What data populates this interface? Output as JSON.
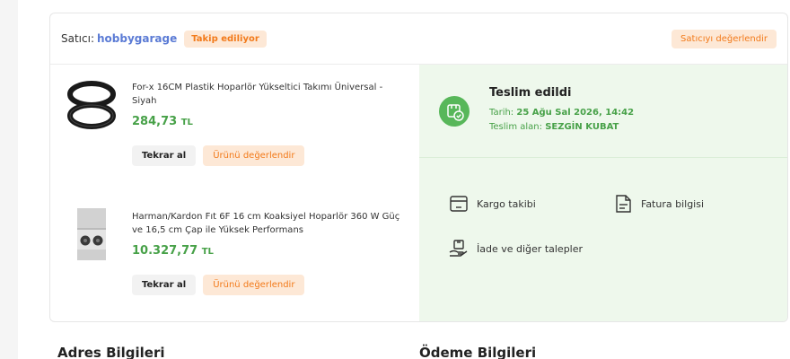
{
  "seller": {
    "prefix": "Satıcı:",
    "name": "hobbygarage",
    "follow_badge": "Takip ediliyor",
    "rate_button": "Satıcıyı değerlendir"
  },
  "products": [
    {
      "title": "For-x 16CM Plastik Hoparlör Yükseltici Takımı Üniversal - Siyah",
      "price": "284,73",
      "currency": "TL",
      "rebuy_label": "Tekrar al",
      "rate_label": "Ürünü değerlendir"
    },
    {
      "title": "Harman/Kardon Fıt 6F 16 cm Koaksiyel Hoparlör 360 W Güç ve 16,5 cm Çap ile Yüksek Performans",
      "price": "10.327,77",
      "currency": "TL",
      "rebuy_label": "Tekrar al",
      "rate_label": "Ürünü değerlendir"
    }
  ],
  "delivery": {
    "title": "Teslim edildi",
    "date_label": "Tarih:",
    "date_value": "25 Ağu Sal 2026, 14:42",
    "receiver_label": "Teslim alan:",
    "receiver_value": "SEZGİN KUBAT",
    "accent_color": "#58b75a"
  },
  "actions": {
    "cargo": "Kargo takibi",
    "invoice": "Fatura bilgisi",
    "returns": "İade ve diğer talepler"
  },
  "sections": {
    "address": "Adres Bilgileri",
    "payment": "Ödeme Bilgileri"
  },
  "colors": {
    "brand_orange": "#f27a1a",
    "price_green": "#47a148",
    "seller_blue": "#5b7bd5"
  }
}
